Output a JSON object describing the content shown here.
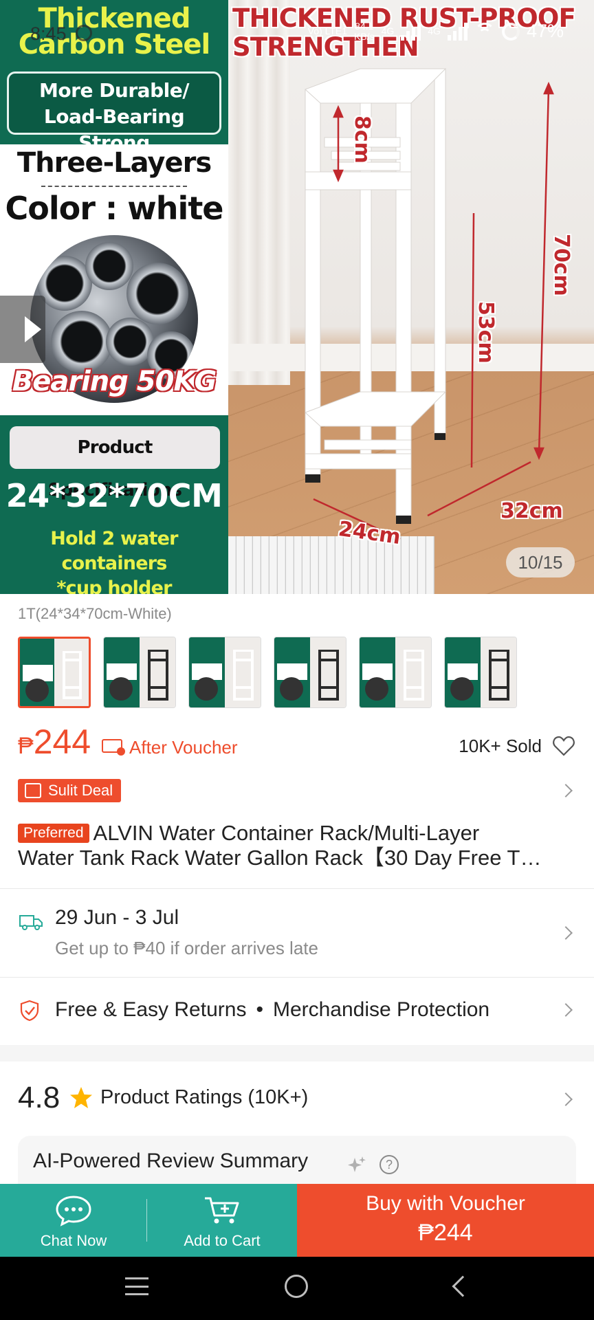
{
  "hero": {
    "left_title": "Thickened Carbon Steel",
    "durable_line1": "More Durable/",
    "durable_line2": "Load-Bearing Strong",
    "layers": "Three-Layers",
    "color": "Color : white",
    "bearing": "Bearing 50KG",
    "spec_label": "Product Specifications",
    "dimensions": "24*32*70CM",
    "hold_line1": "Hold 2 water containers",
    "hold_line2": "*cup holder",
    "right_title_line1": "THICKENED RUST-PROOF",
    "right_title_line2": "STRENGTHEN",
    "dim_8": "8cm",
    "dim_70": "70cm",
    "dim_53": "53cm",
    "dim_32": "32cm",
    "dim_24": "24cm",
    "counter": "10/15"
  },
  "status_bar": {
    "time": "8:45",
    "net_line1": "Vo) LTE1",
    "speed_line1": "84.1",
    "speed_line2": "KB/s",
    "net_type1": "4G",
    "net_type2": "4G",
    "battery": "47%"
  },
  "variant": {
    "selected_label": "1T(24*34*70cm-White)",
    "thumbnails": [
      {
        "name": "white-1",
        "dark": false
      },
      {
        "name": "black-1",
        "dark": true
      },
      {
        "name": "white-2",
        "dark": false
      },
      {
        "name": "black-2",
        "dark": true
      },
      {
        "name": "white-3",
        "dark": false
      },
      {
        "name": "black-3",
        "dark": true
      }
    ]
  },
  "price": {
    "currency": "₱",
    "amount": "244",
    "after_voucher": "After Voucher",
    "sold": "10K+ Sold"
  },
  "deal": {
    "label": "Sulit Deal"
  },
  "product": {
    "badge": "Preferred",
    "title_line1": "ALVIN Water Container Rack/Multi-Layer",
    "title_line2": "Water Tank Rack Water Gallon Rack【30 Day Free T…"
  },
  "delivery": {
    "date": "29 Jun - 3 Jul",
    "note": "Get up to ₱40 if order arrives late"
  },
  "returns": {
    "left": "Free & Easy Returns",
    "separator": "•",
    "right": "Merchandise Protection"
  },
  "ratings": {
    "score": "4.8",
    "label": "Product Ratings (10K+)"
  },
  "ai_summary": {
    "title": "AI-Powered Review Summary",
    "help": "?"
  },
  "bottom_bar": {
    "chat": "Chat Now",
    "cart": "Add to Cart",
    "buy_label": "Buy with Voucher",
    "buy_price": "₱244"
  },
  "colors": {
    "accent": "#ee4d2d",
    "teal": "#26aa99",
    "banner_green": "#0f6b52"
  }
}
